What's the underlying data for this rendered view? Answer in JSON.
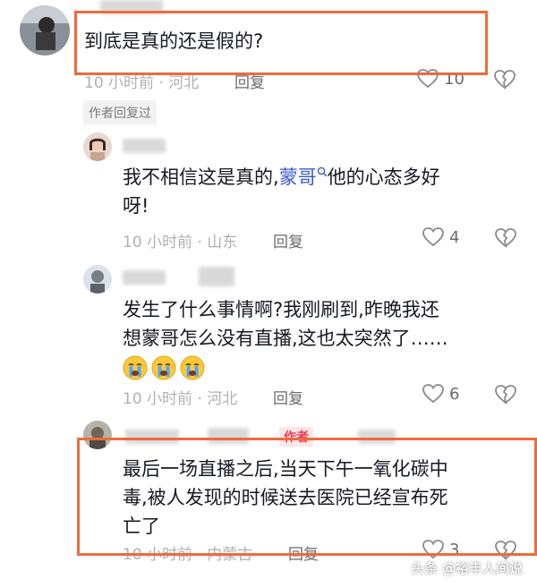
{
  "comments": [
    {
      "text": "到底是真的还是假的?",
      "time": "10 小时前",
      "location": "河北",
      "reply_label": "回复",
      "likes": "10"
    },
    {
      "badge": "作者回复过"
    },
    {
      "text_before": "我不相信这是真的,",
      "mention": "蒙哥",
      "text_after": "他的心态多好",
      "text_line2": "呀!",
      "time": "10 小时前",
      "location": "山东",
      "reply_label": "回复",
      "likes": "4"
    },
    {
      "line1": "发生了什么事情啊?我刚刷到,昨晚我还",
      "line2": "想蒙哥怎么没有直播,这也太突然了……",
      "emoji_count": 3,
      "time": "10 小时前",
      "location": "河北",
      "reply_label": "回复",
      "likes": "6"
    },
    {
      "author_tag": "作者",
      "line1": "最后一场直播之后,当天下午一氧化碳中",
      "line2": "毒,被人发现的时候送去医院已经宣布死",
      "line3": "亡了",
      "time": "10 小时前",
      "location": "内蒙古",
      "reply_label": "回复",
      "likes": "3"
    }
  ],
  "watermark": "头条 @裕丰人间说",
  "colors": {
    "highlight": "#f06a3c",
    "mention": "#3b5bd6",
    "author_tag": "#f0384f"
  },
  "icons": [
    "heart-icon",
    "broken-heart-icon",
    "search-mini-icon",
    "crying-emoji-icon"
  ]
}
